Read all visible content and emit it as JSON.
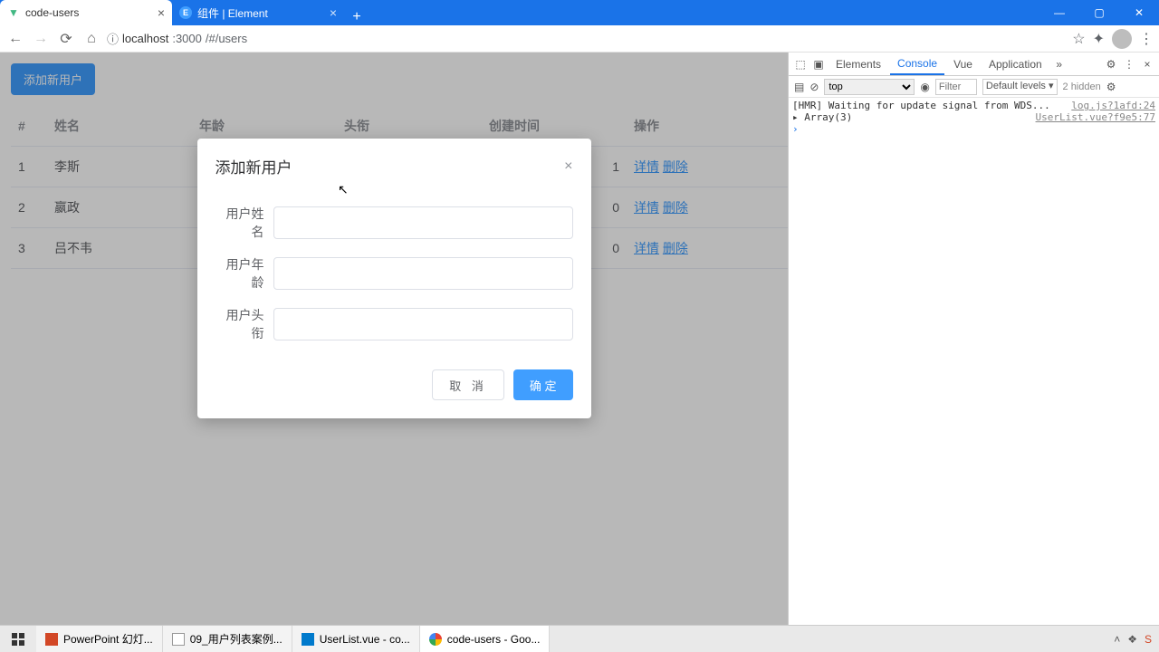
{
  "browser": {
    "tabs": [
      {
        "title": "code-users",
        "active": true
      },
      {
        "title": "组件 | Element",
        "active": false
      }
    ],
    "url_host": "localhost",
    "url_port": ":3000",
    "url_path": "/#/users"
  },
  "page": {
    "add_button": "添加新用户",
    "columns": {
      "idx": "#",
      "name": "姓名",
      "age": "年龄",
      "title": "头衔",
      "created": "创建时间",
      "ops": "操作"
    },
    "op_detail": "详情",
    "op_delete": "删除",
    "rows": [
      {
        "idx": "1",
        "name": "李斯",
        "tail": "1"
      },
      {
        "idx": "2",
        "name": "嬴政",
        "tail": "0"
      },
      {
        "idx": "3",
        "name": "吕不韦",
        "tail": "0"
      }
    ]
  },
  "dialog": {
    "title": "添加新用户",
    "fields": {
      "name": "用户姓名",
      "age": "用户年龄",
      "title": "用户头衔"
    },
    "cancel": "取 消",
    "confirm": "确 定"
  },
  "devtools": {
    "tabs": {
      "elements": "Elements",
      "console": "Console",
      "vue": "Vue",
      "application": "Application"
    },
    "context": "top",
    "filter_placeholder": "Filter",
    "levels": "Default levels ▾",
    "hidden": "2 hidden",
    "lines": [
      {
        "msg": "[HMR] Waiting for update signal from WDS...",
        "src": "log.js?1afd:24"
      },
      {
        "msg": "▸ Array(3)",
        "src": "UserList.vue?f9e5:77"
      }
    ]
  },
  "taskbar": {
    "items": [
      {
        "label": "PowerPoint 幻灯..."
      },
      {
        "label": "09_用户列表案例..."
      },
      {
        "label": "UserList.vue - co..."
      },
      {
        "label": "code-users - Goo...",
        "active": true
      }
    ]
  }
}
